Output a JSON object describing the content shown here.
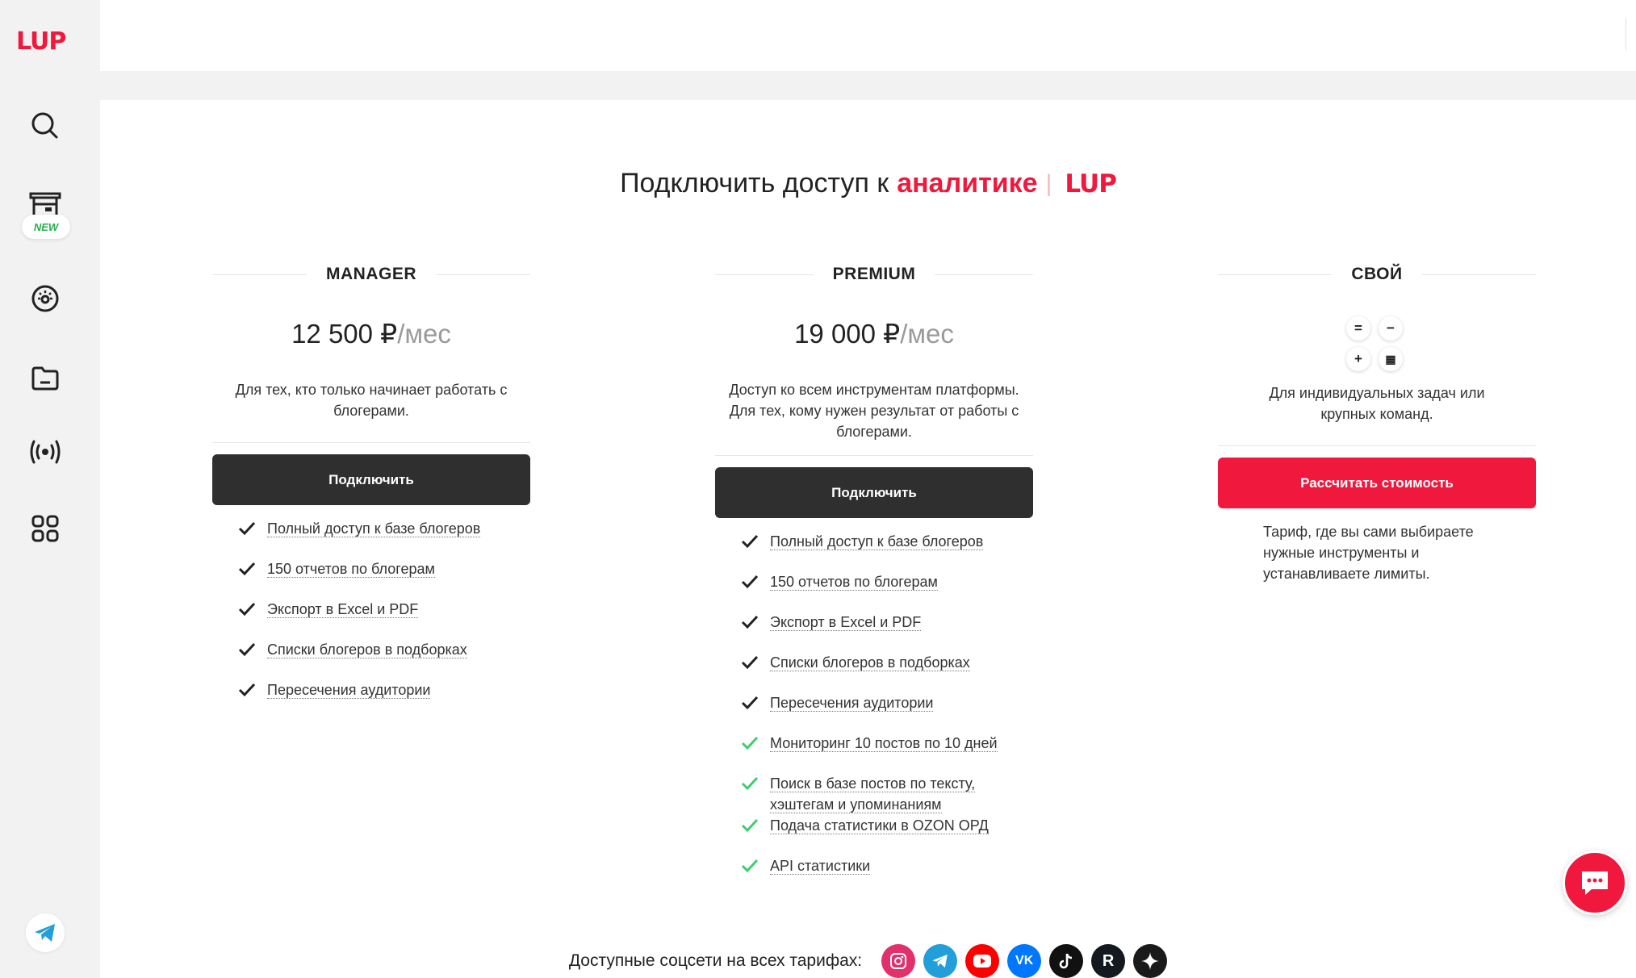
{
  "brand": {
    "logo_text": "LUP",
    "accent_color": "#f0183c",
    "dark_button_color": "#2f2f2f"
  },
  "sidebar": {
    "items": [
      {
        "icon": "search-icon"
      },
      {
        "icon": "store-icon",
        "badge": "NEW"
      },
      {
        "icon": "analytics-dial-icon"
      },
      {
        "icon": "folder-icon"
      },
      {
        "icon": "broadcast-icon"
      },
      {
        "icon": "apps-grid-icon"
      }
    ],
    "footer_icon": "telegram-icon"
  },
  "header": {
    "avatar_icon": "user-avatar-icon",
    "menu_icon": "chevron-down-icon"
  },
  "page": {
    "title_prefix": "Подключить доступ к",
    "title_accent": "аналитике",
    "title_logo": "LUP"
  },
  "plans": [
    {
      "name": "MANAGER",
      "price": "12 500 ₽",
      "per": "/мес",
      "description": "Для тех, кто только начинает работать с блогерами.",
      "button": "Подключить",
      "features": [
        {
          "text": "Полный доступ к базе блогеров",
          "check_color": "#222222"
        },
        {
          "text": "150 отчетов по блогерам",
          "check_color": "#222222"
        },
        {
          "text": "Экспорт в Excel и PDF",
          "check_color": "#222222"
        },
        {
          "text": "Списки блогеров в подборках",
          "check_color": "#222222"
        },
        {
          "text": "Пересечения аудитории",
          "check_color": "#222222"
        }
      ]
    },
    {
      "name": "PREMIUM",
      "price": "19 000 ₽",
      "per": "/мес",
      "description": "Доступ ко всем инструментам платформы. Для тех, кому нужен результат от работы с блогерами.",
      "button": "Подключить",
      "features": [
        {
          "text": "Полный доступ к базе блогеров",
          "check_color": "#222222"
        },
        {
          "text": "150 отчетов по блогерам",
          "check_color": "#222222"
        },
        {
          "text": "Экспорт в Excel и PDF",
          "check_color": "#222222"
        },
        {
          "text": "Списки блогеров в подборках",
          "check_color": "#222222"
        },
        {
          "text": "Пересечения аудитории",
          "check_color": "#222222"
        },
        {
          "text": "Мониторинг 10 постов по 10 дней",
          "check_color": "#3ccf6a"
        },
        {
          "text": "Поиск в базе постов по тексту, хэштегам и упоминаниям",
          "check_color": "#3ccf6a"
        },
        {
          "text": "Подача статистики в OZON ОРД",
          "check_color": "#3ccf6a"
        },
        {
          "text": "API статистики",
          "check_color": "#3ccf6a"
        }
      ]
    },
    {
      "name": "СВОЙ",
      "calc_symbols": [
        "=",
        "−",
        "+",
        "▦"
      ],
      "description": "Для индивидуальных задач или крупных команд.",
      "button": "Рассчитать стоимость",
      "note": "Тариф, где вы сами выбираете нужные инструменты и устанавливаете лимиты."
    }
  ],
  "socials": {
    "label": "Доступные соцсети на всех тарифах:",
    "items": [
      {
        "icon": "instagram-icon",
        "color": "#e1306c"
      },
      {
        "icon": "telegram-icon",
        "color": "#229ed9"
      },
      {
        "icon": "youtube-icon",
        "color": "#ff0000"
      },
      {
        "icon": "vk-icon",
        "color": "#0077ff"
      },
      {
        "icon": "tiktok-icon",
        "color": "#111111"
      },
      {
        "icon": "rutube-icon",
        "color": "#14191f"
      },
      {
        "icon": "dzen-icon",
        "color": "#1a1a1a"
      }
    ]
  },
  "chat": {
    "icon": "chat-bubble-icon"
  }
}
